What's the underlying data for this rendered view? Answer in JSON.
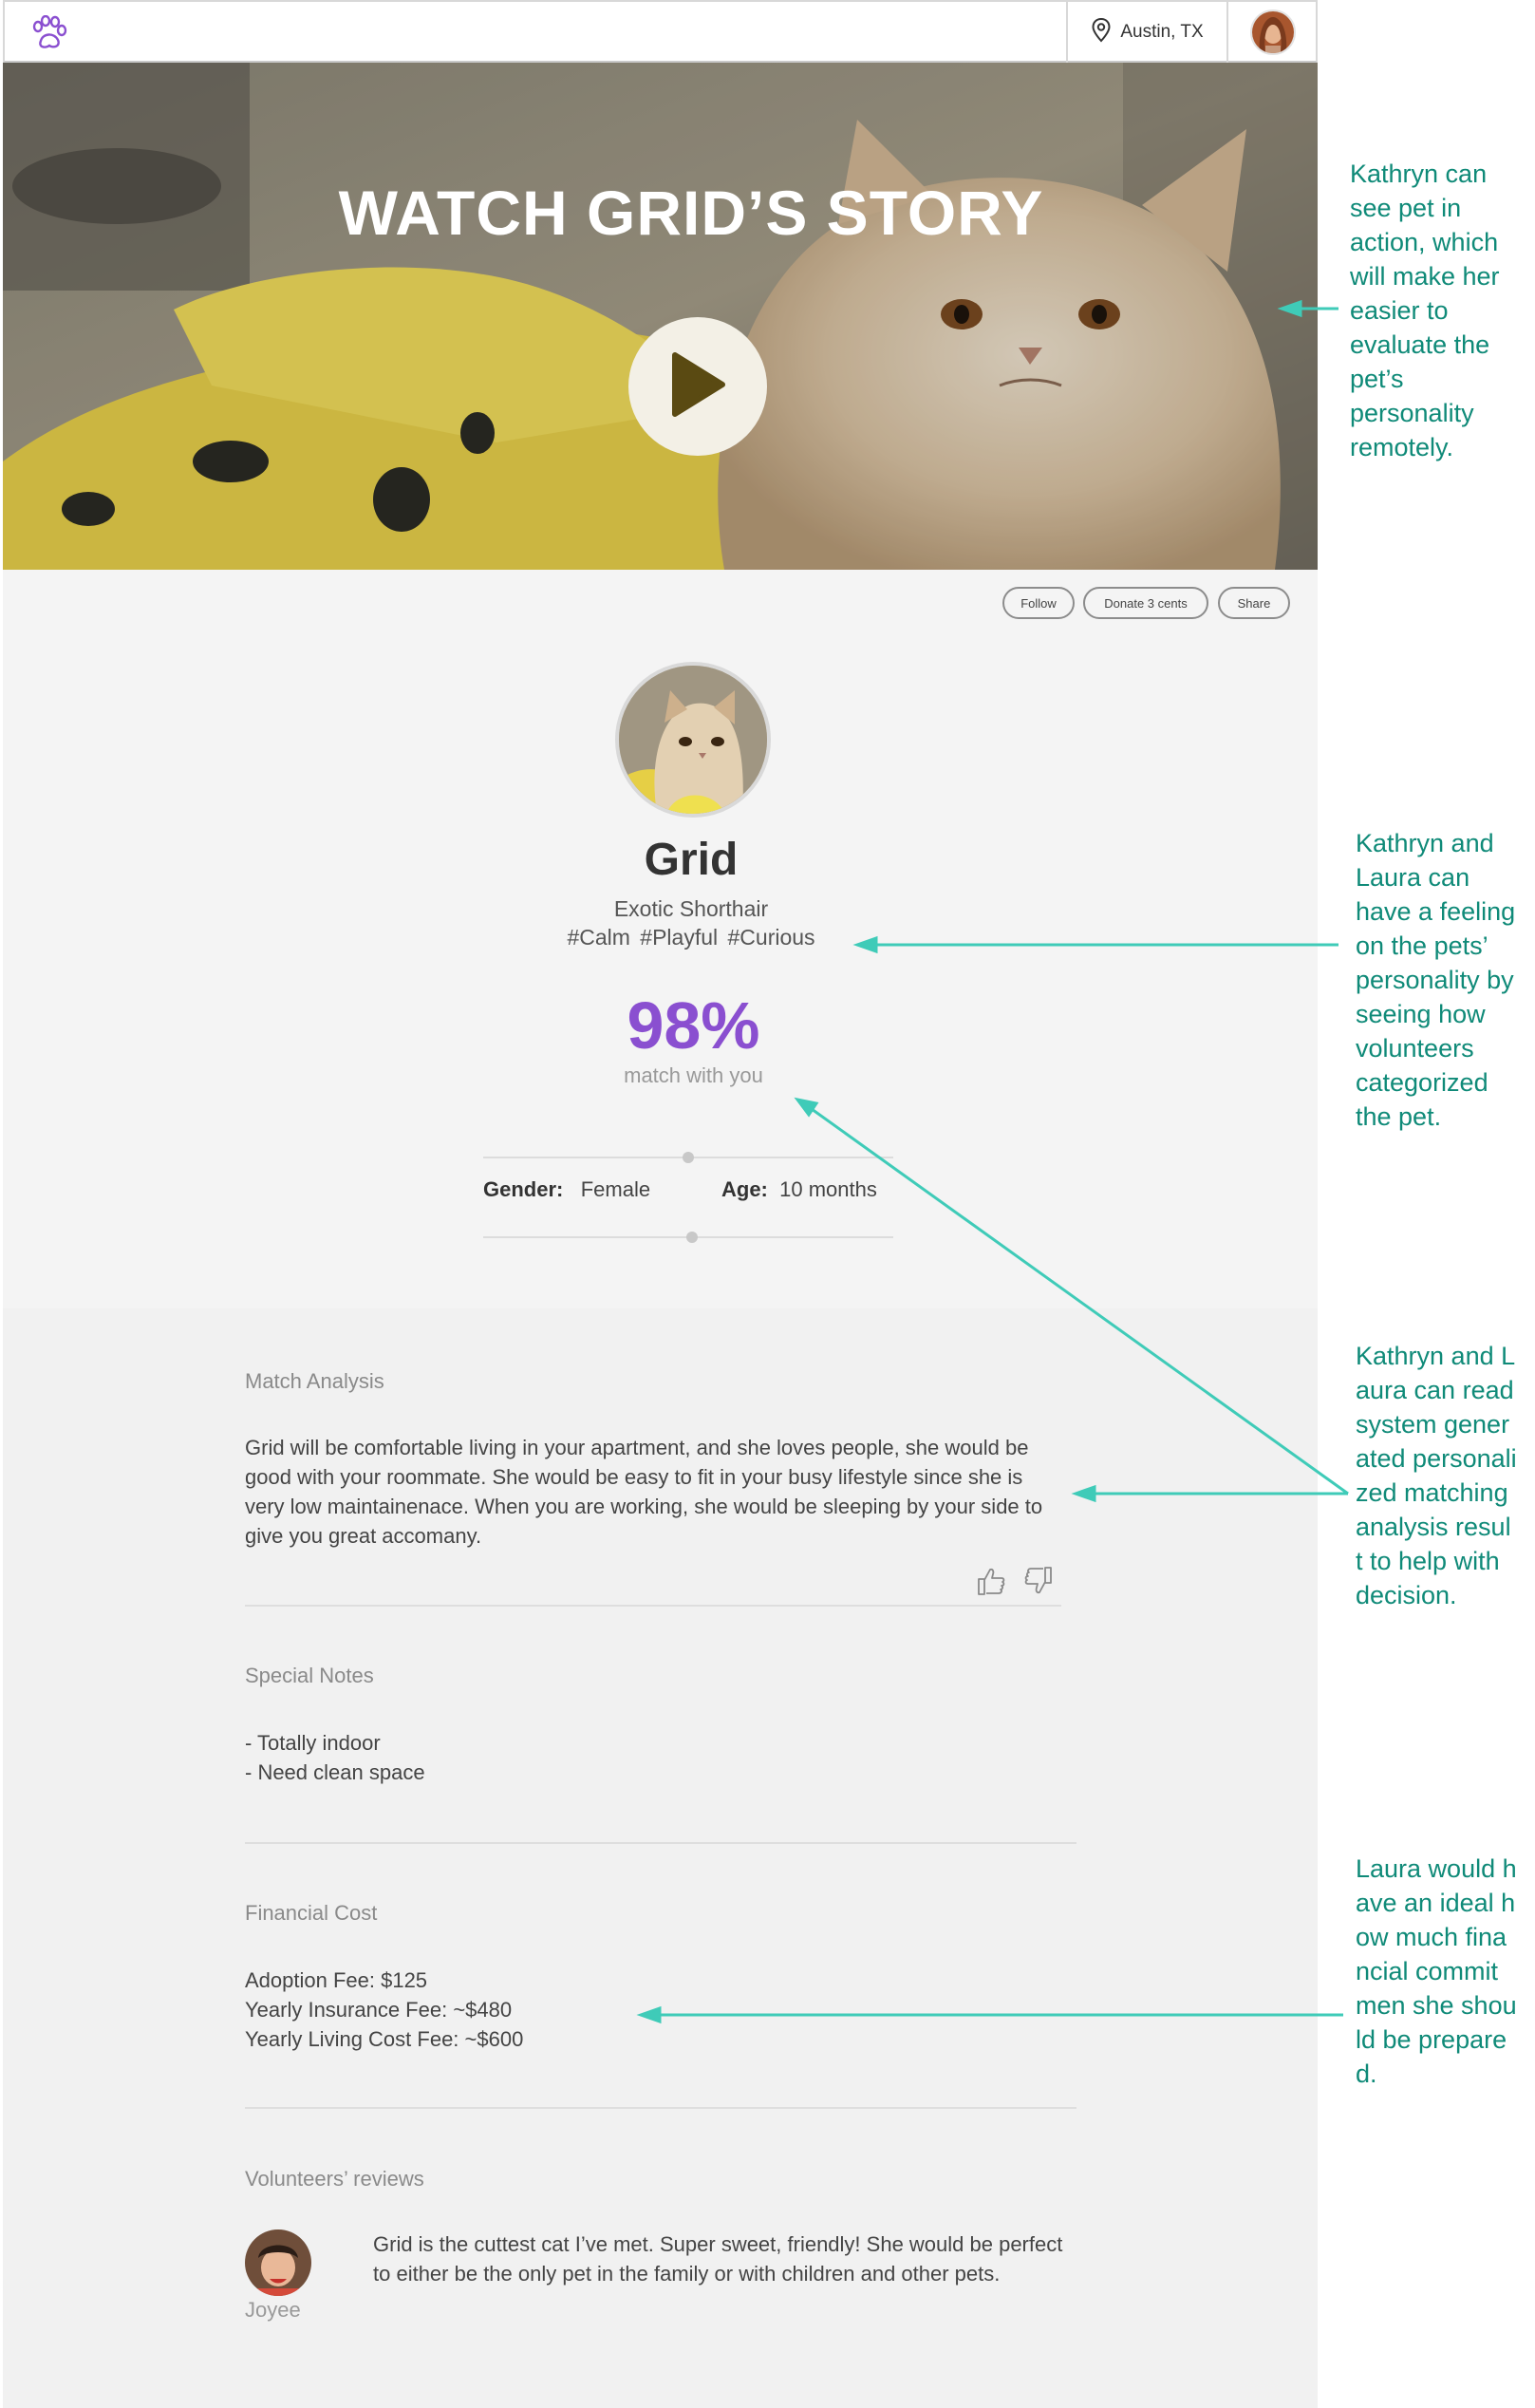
{
  "header": {
    "logo_icon": "paw-print-icon",
    "location": "Austin, TX",
    "location_icon": "map-pin-icon",
    "profile_icon": "user-avatar"
  },
  "hero": {
    "title": "WATCH GRID’S STORY",
    "play_icon": "play-icon"
  },
  "actions": {
    "follow": "Follow",
    "donate": "Donate 3 cents",
    "share": "Share"
  },
  "pet": {
    "name": "Grid",
    "breed": "Exotic Shorthair",
    "tags": "#Calm  #Playful  #Curious",
    "match_percent": "98%",
    "match_label": "match with you",
    "gender_label": "Gender:",
    "gender_value": "Female",
    "age_label": "Age:",
    "age_value": "10 months"
  },
  "sections": {
    "match_analysis": {
      "title": "Match Analysis",
      "body": "Grid will be comfortable living in your apartment, and she loves people, she would be good with your roommate.  She would be easy to fit in your busy lifestyle since she is very low maintainenace. When you are working, she would be sleeping by your side to give you great accomany."
    },
    "special_notes": {
      "title": "Special Notes",
      "items": [
        "- Totally indoor",
        "- Need clean space"
      ]
    },
    "financial_cost": {
      "title": "Financial Cost",
      "items": [
        "Adoption Fee: $125",
        "Yearly Insurance Fee: ~$480",
        "Yearly Living Cost Fee: ~$600"
      ]
    },
    "reviews": {
      "title": "Volunteers’ reviews",
      "reviewer": "Joyee",
      "text": "Grid is the cuttest cat I’ve met. Super sweet, friendly! She would be perfect to either be the only pet in the family or with children and other pets."
    }
  },
  "annotations": [
    "Kathryn can see pet in action, which will make her easier to evaluate the pet’s personality remotely.",
    "Kathryn and Laura can have a feeling on the pets’ personality by seeing how volunteers categorized the pet.",
    "Kathryn and Laura can read system generated personalized matching analysis result to help with decision.",
    "Laura would have an ideal how much financial commitmen she should be prepared."
  ],
  "colors": {
    "accent_purple": "#8a4fd0",
    "annotation_teal": "#0f8a78",
    "arrow_teal": "#3fcbb8"
  }
}
